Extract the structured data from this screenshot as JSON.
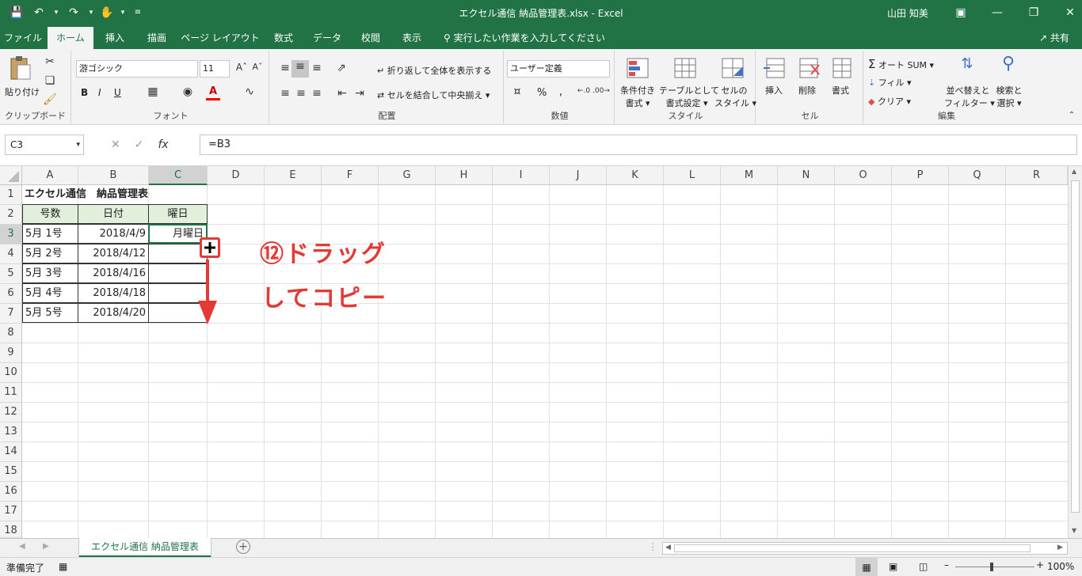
{
  "window": {
    "title": "エクセル通信 納品管理表.xlsx  -  Excel",
    "user": "山田 知美"
  },
  "tabs": [
    {
      "label": "ファイル"
    },
    {
      "label": "ホーム"
    },
    {
      "label": "挿入"
    },
    {
      "label": "描画"
    },
    {
      "label": "ページ レイアウト"
    },
    {
      "label": "数式"
    },
    {
      "label": "データ"
    },
    {
      "label": "校閲"
    },
    {
      "label": "表示"
    }
  ],
  "tell_me": "実行したい作業を入力してください",
  "share": "共有",
  "ribbon": {
    "clipboard": {
      "label": "クリップボード",
      "paste": "貼り付け"
    },
    "font": {
      "label": "フォント",
      "name": "游ゴシック",
      "size": "11",
      "bold": "B",
      "italic": "I",
      "underline": "U"
    },
    "alignment": {
      "label": "配置",
      "wrap": "折り返して全体を表示する",
      "merge": "セルを結合して中央揃え"
    },
    "number": {
      "label": "数値",
      "format": "ユーザー定義",
      "percent": "%"
    },
    "styles": {
      "label": "スタイル",
      "conditional": "条件付き",
      "conditional2": "書式",
      "table": "テーブルとして",
      "table2": "書式設定",
      "cell": "セルの",
      "cell2": "スタイル"
    },
    "cells": {
      "label": "セル",
      "insert": "挿入",
      "delete": "削除",
      "format": "書式"
    },
    "editing": {
      "label": "編集",
      "autosum": "オート SUM",
      "fill": "フィル",
      "clear": "クリア",
      "sort": "並べ替えと",
      "sort2": "フィルター",
      "find": "検索と",
      "find2": "選択"
    }
  },
  "formula_bar": {
    "name_box": "C3",
    "formula": "=B3"
  },
  "columns": [
    "A",
    "B",
    "C",
    "D",
    "E",
    "F",
    "G",
    "H",
    "I",
    "J",
    "K",
    "L",
    "M",
    "N",
    "O",
    "P",
    "Q",
    "R"
  ],
  "rows": [
    "1",
    "2",
    "3",
    "4",
    "5",
    "6",
    "7",
    "8",
    "9",
    "10",
    "11",
    "12",
    "13",
    "14",
    "15",
    "16",
    "17",
    "18"
  ],
  "cells": {
    "title": "エクセル通信　納品管理表",
    "headers": [
      "号数",
      "日付",
      "曜日"
    ],
    "data": [
      [
        "5月 1号",
        "2018/4/9",
        "月曜日"
      ],
      [
        "5月 2号",
        "2018/4/12",
        ""
      ],
      [
        "5月 3号",
        "2018/4/16",
        ""
      ],
      [
        "5月 4号",
        "2018/4/18",
        ""
      ],
      [
        "5月 5号",
        "2018/4/20",
        ""
      ]
    ]
  },
  "annotation": {
    "line1": "⑫ドラッグ",
    "line2": "してコピー",
    "color": "#e53935"
  },
  "sheet_tab": "エクセル通信  納品管理表",
  "status": {
    "ready": "準備完了",
    "zoom": "100%"
  },
  "colors": {
    "accent": "#217346",
    "header_fill": "#e2efda"
  }
}
